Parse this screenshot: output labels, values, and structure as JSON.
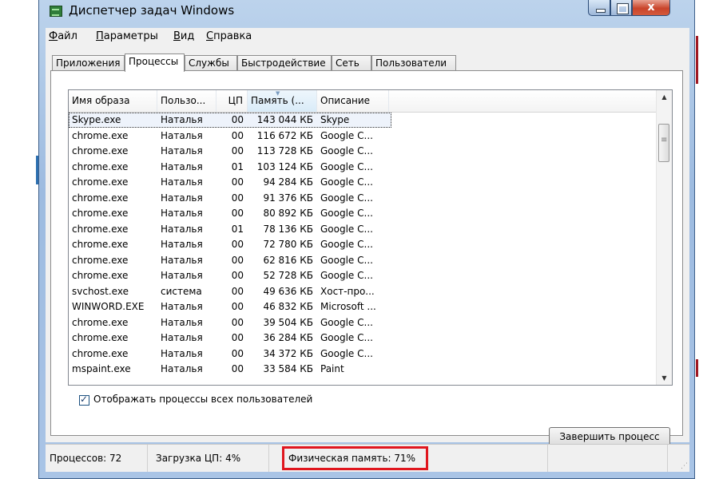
{
  "window": {
    "title": "Диспетчер задач Windows",
    "controls": {
      "minimize": "",
      "maximize": "",
      "close": "x"
    }
  },
  "menu": [
    {
      "text": "Файл",
      "accel": "Ф",
      "rest": "айл"
    },
    {
      "text": "Параметры",
      "accel": "П",
      "rest": "араметры"
    },
    {
      "text": "Вид",
      "accel": "В",
      "rest": "ид"
    },
    {
      "text": "Справка",
      "accel": "С",
      "rest": "правка"
    }
  ],
  "tabs": [
    "Приложения",
    "Процессы",
    "Службы",
    "Быстродействие",
    "Сеть",
    "Пользователи"
  ],
  "active_tab": "Процессы",
  "table": {
    "columns": [
      "Имя образа",
      "Пользо...",
      "ЦП",
      "Память (...",
      "Описание"
    ],
    "sorted_column": "Память (...",
    "rows": [
      [
        "Skype.exe",
        "Наталья",
        "00",
        "143 044 КБ",
        "Skype"
      ],
      [
        "chrome.exe",
        "Наталья",
        "00",
        "116 672 КБ",
        "Google C..."
      ],
      [
        "chrome.exe",
        "Наталья",
        "00",
        "113 728 КБ",
        "Google C..."
      ],
      [
        "chrome.exe",
        "Наталья",
        "01",
        "103 124 КБ",
        "Google C..."
      ],
      [
        "chrome.exe",
        "Наталья",
        "00",
        "94 284 КБ",
        "Google C..."
      ],
      [
        "chrome.exe",
        "Наталья",
        "00",
        "91 376 КБ",
        "Google C..."
      ],
      [
        "chrome.exe",
        "Наталья",
        "00",
        "80 892 КБ",
        "Google C..."
      ],
      [
        "chrome.exe",
        "Наталья",
        "01",
        "78 136 КБ",
        "Google C..."
      ],
      [
        "chrome.exe",
        "Наталья",
        "00",
        "72 780 КБ",
        "Google C..."
      ],
      [
        "chrome.exe",
        "Наталья",
        "00",
        "62 816 КБ",
        "Google C..."
      ],
      [
        "chrome.exe",
        "Наталья",
        "00",
        "52 728 КБ",
        "Google C..."
      ],
      [
        "svchost.exe",
        "система",
        "00",
        "49 636 КБ",
        "Хост-про..."
      ],
      [
        "WINWORD.EXE",
        "Наталья",
        "00",
        "46 832 КБ",
        "Microsoft ..."
      ],
      [
        "chrome.exe",
        "Наталья",
        "00",
        "39 504 КБ",
        "Google C..."
      ],
      [
        "chrome.exe",
        "Наталья",
        "00",
        "36 284 КБ",
        "Google C..."
      ],
      [
        "chrome.exe",
        "Наталья",
        "00",
        "34 372 КБ",
        "Google C..."
      ],
      [
        "mspaint.exe",
        "Наталья",
        "00",
        "33 584 КБ",
        "Paint"
      ]
    ],
    "selected_row": 0
  },
  "show_all_users": {
    "label": "Отображать процессы всех пользователей",
    "checked": true
  },
  "end_process_button": "Завершить процесс",
  "status": {
    "processes": "Процессов: 72",
    "cpu": "Загрузка ЦП: 4%",
    "memory": "Физическая память: 71%"
  },
  "colors": {
    "highlight_border": "#e0161e",
    "title_gradient": "#9dbbe0",
    "close_button": "#c9442b"
  }
}
